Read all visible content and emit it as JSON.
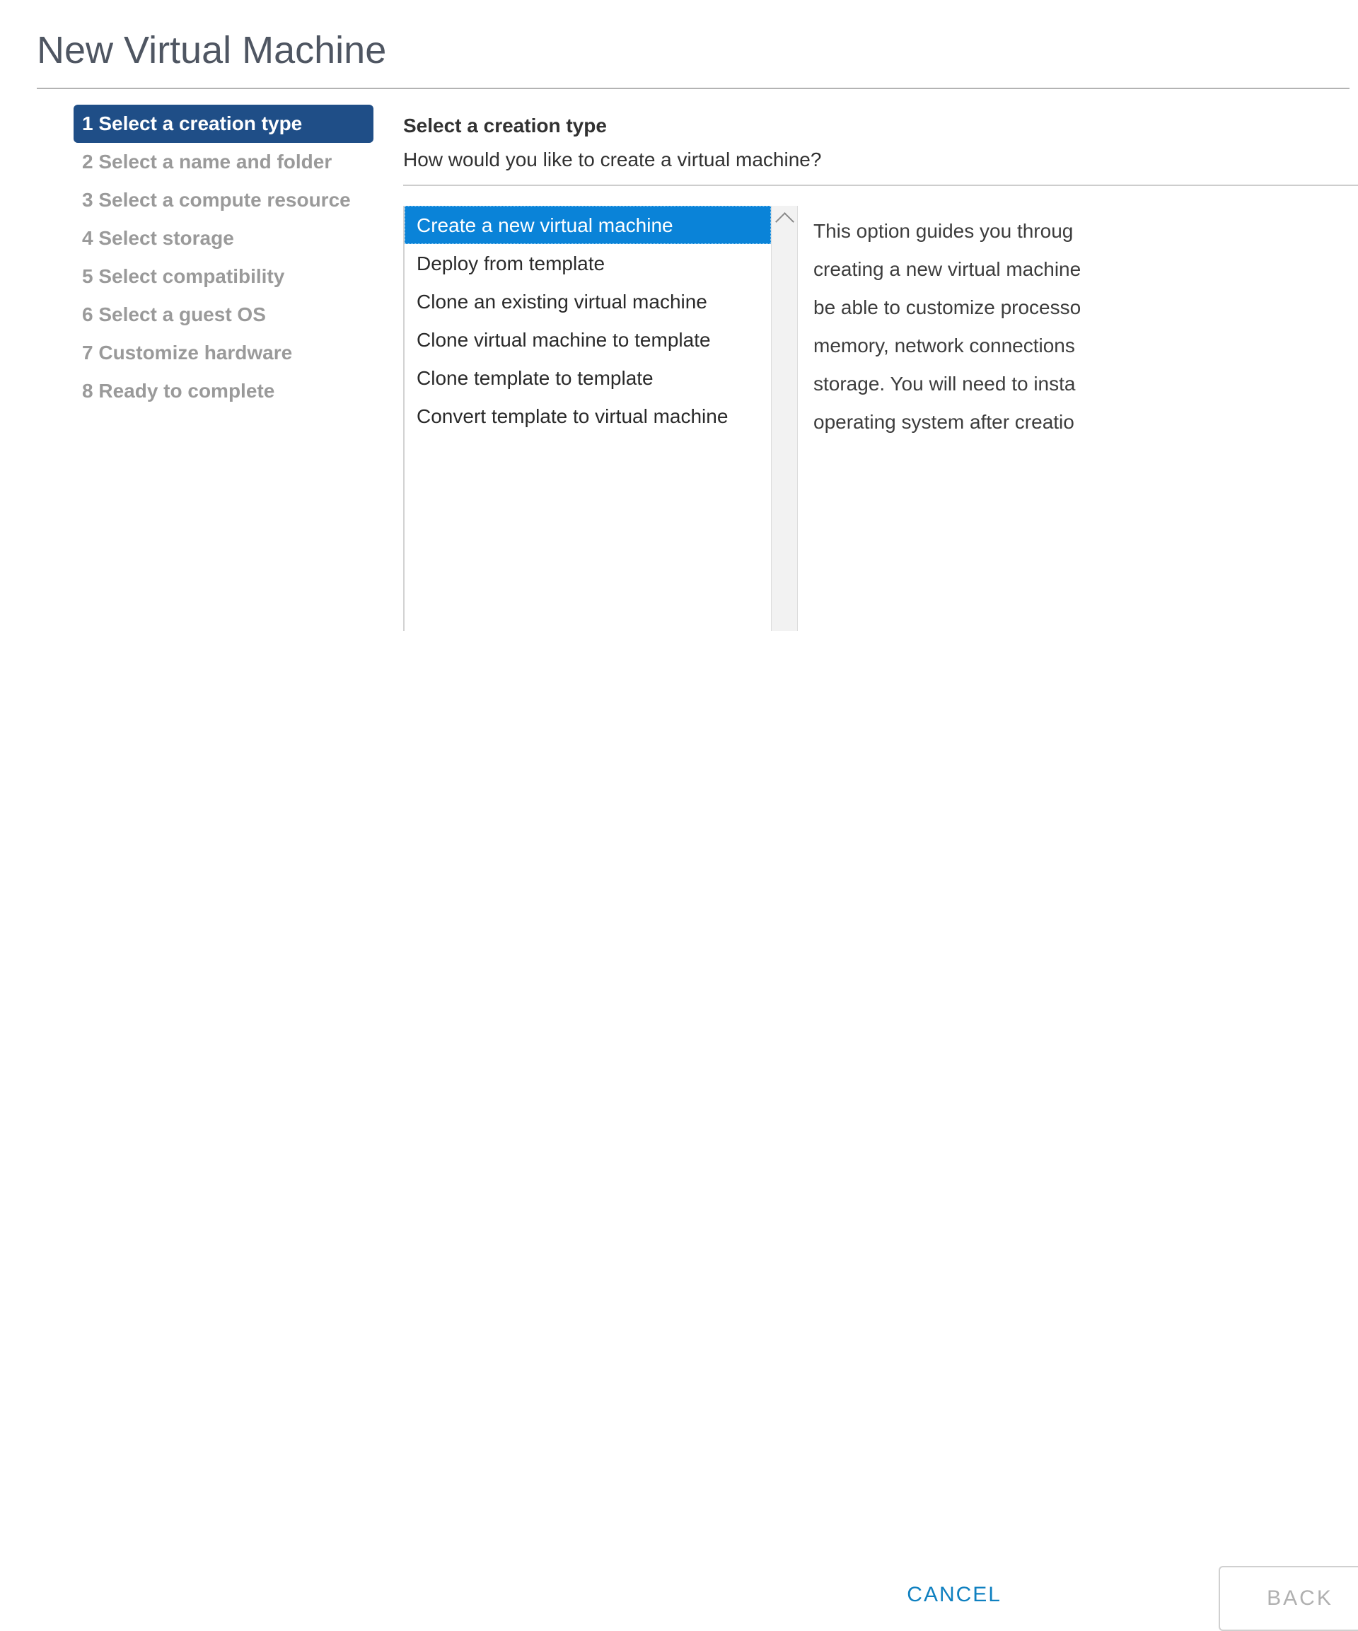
{
  "dialog": {
    "title": "New Virtual Machine"
  },
  "steps": [
    {
      "number": "1",
      "label": "Select a creation type",
      "text": "1 Select a creation type",
      "active": true
    },
    {
      "number": "2",
      "label": "Select a name and folder",
      "text": "2 Select a name and folder",
      "active": false
    },
    {
      "number": "3",
      "label": "Select a compute resource",
      "text": "3 Select a compute resource",
      "active": false
    },
    {
      "number": "4",
      "label": "Select storage",
      "text": "4 Select storage",
      "active": false
    },
    {
      "number": "5",
      "label": "Select compatibility",
      "text": "5 Select compatibility",
      "active": false
    },
    {
      "number": "6",
      "label": "Select a guest OS",
      "text": "6 Select a guest OS",
      "active": false
    },
    {
      "number": "7",
      "label": "Customize hardware",
      "text": "7 Customize hardware",
      "active": false
    },
    {
      "number": "8",
      "label": "Ready to complete",
      "text": "8 Ready to complete",
      "active": false
    }
  ],
  "content": {
    "title": "Select a creation type",
    "subtitle": "How would you like to create a virtual machine?"
  },
  "creation_types": {
    "selected": "Create a new virtual machine",
    "options": [
      "Create a new virtual machine",
      "Deploy from template",
      "Clone an existing virtual machine",
      "Clone virtual machine to template",
      "Clone template to template",
      "Convert template to virtual machine"
    ]
  },
  "description": {
    "lines": [
      "This option guides you throug",
      "creating a new virtual machine",
      "be able to customize processo",
      "memory, network connections",
      "storage. You will need to insta",
      "operating system after creatio"
    ]
  },
  "footer": {
    "cancel_label": "CANCEL",
    "back_label": "BACK"
  },
  "colors": {
    "active_step": "#1f4e87",
    "selection": "#0a83d8",
    "link": "#0f80c0",
    "title_text": "#4f5662",
    "muted_text": "#9a9a9a"
  }
}
